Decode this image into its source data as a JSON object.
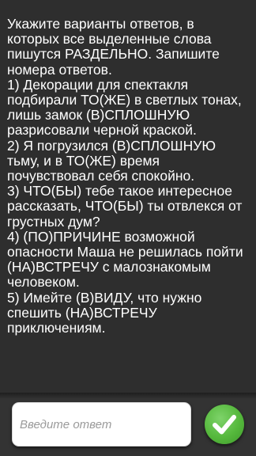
{
  "task": {
    "text": "Укажите варианты ответов, в которых все выделенные слова пишутся РАЗДЕЛЬНО. Запишите номера ответов.\n1) Декорации для спектакля подбирали ТО(ЖЕ) в светлых тонах, лишь замок (В)СПЛОШНУЮ разрисовали черной краской.\n2) Я погрузился (В)СПЛОШНУЮ тьму, и в ТО(ЖЕ) время почувствовал себя спокойно.\n3) ЧТО(БЫ) тебе такое интересное рассказать, ЧТО(БЫ) ты отвлекся от грустных дум?\n4) (ПО)ПРИЧИНЕ возможной опасности Маша не решилась пойти (НА)ВСТРЕЧУ с малознакомым человеком.\n5) Имейте (В)ВИДУ, что нужно спешить (НА)ВСТРЕЧУ приключениям."
  },
  "answer": {
    "placeholder": "Введите ответ",
    "value": ""
  },
  "submit": {
    "icon": "checkmark-icon",
    "color": "#55b83c"
  }
}
